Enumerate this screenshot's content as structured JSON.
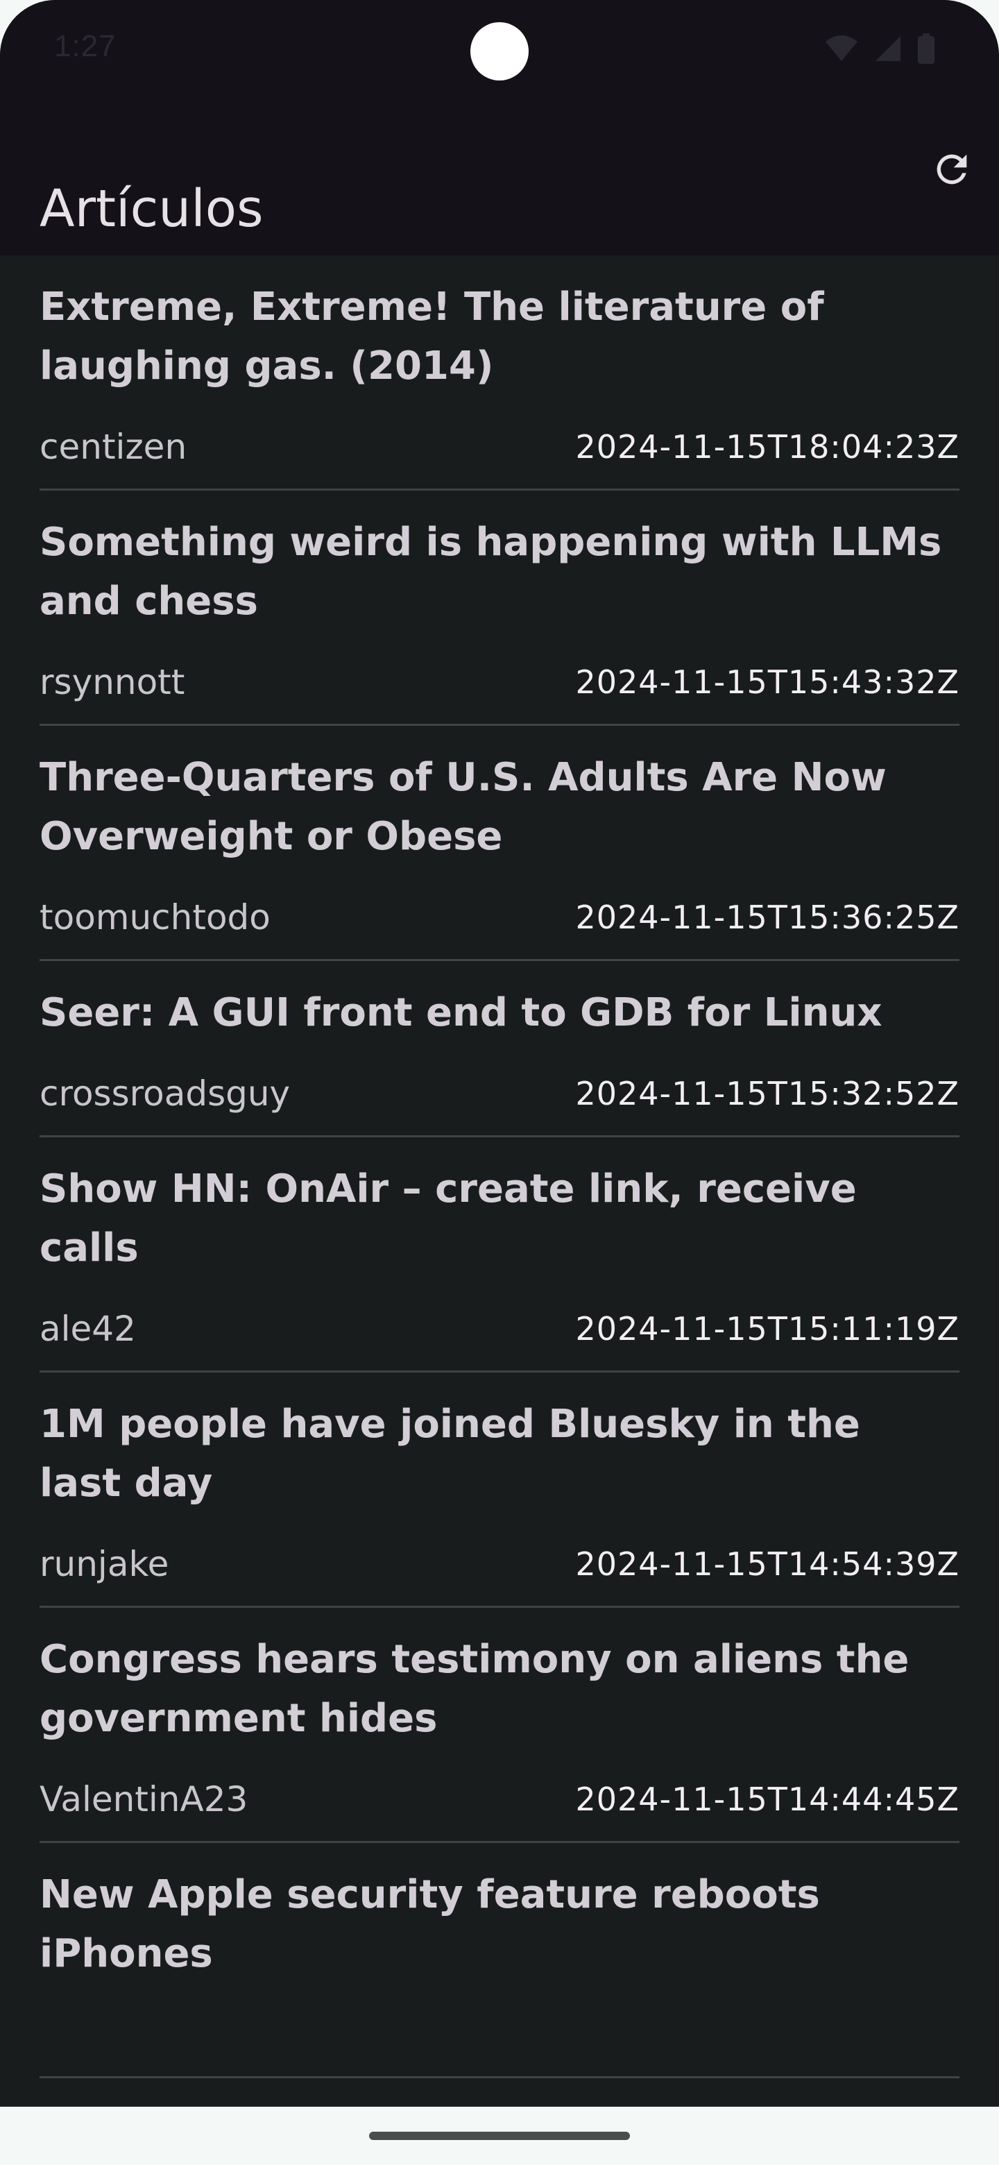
{
  "status_bar": {
    "time": "1:27",
    "icons": [
      "wifi-icon",
      "cell-signal-icon",
      "battery-icon"
    ]
  },
  "app_bar": {
    "title": "Artículos",
    "refresh_icon": "refresh-icon"
  },
  "articles": [
    {
      "title": "Extreme, Extreme! The literature of laughing gas. (2014)",
      "author": "centizen",
      "time": "2024-11-15T18:04:23Z"
    },
    {
      "title": "Something weird is happening with LLMs and chess",
      "author": "rsynnott",
      "time": "2024-11-15T15:43:32Z"
    },
    {
      "title": "Three-Quarters of U.S. Adults Are Now Overweight or Obese",
      "author": "toomuchtodo",
      "time": "2024-11-15T15:36:25Z"
    },
    {
      "title": "Seer: A GUI front end to GDB for Linux",
      "author": "crossroadsguy",
      "time": "2024-11-15T15:32:52Z"
    },
    {
      "title": "Show HN: OnAir – create link, receive calls",
      "author": "ale42",
      "time": "2024-11-15T15:11:19Z"
    },
    {
      "title": "1M people have joined Bluesky in the last day",
      "author": "runjake",
      "time": "2024-11-15T14:54:39Z"
    },
    {
      "title": "Congress hears testimony on aliens the government hides",
      "author": "ValentinA23",
      "time": "2024-11-15T14:44:45Z"
    },
    {
      "title": "New Apple security feature reboots iPhones",
      "author": "",
      "time": ""
    }
  ],
  "colors": {
    "background": "#191c1c",
    "app_bar": "#141218",
    "title_text": "#d3ced6",
    "divider": "#3e4442"
  }
}
